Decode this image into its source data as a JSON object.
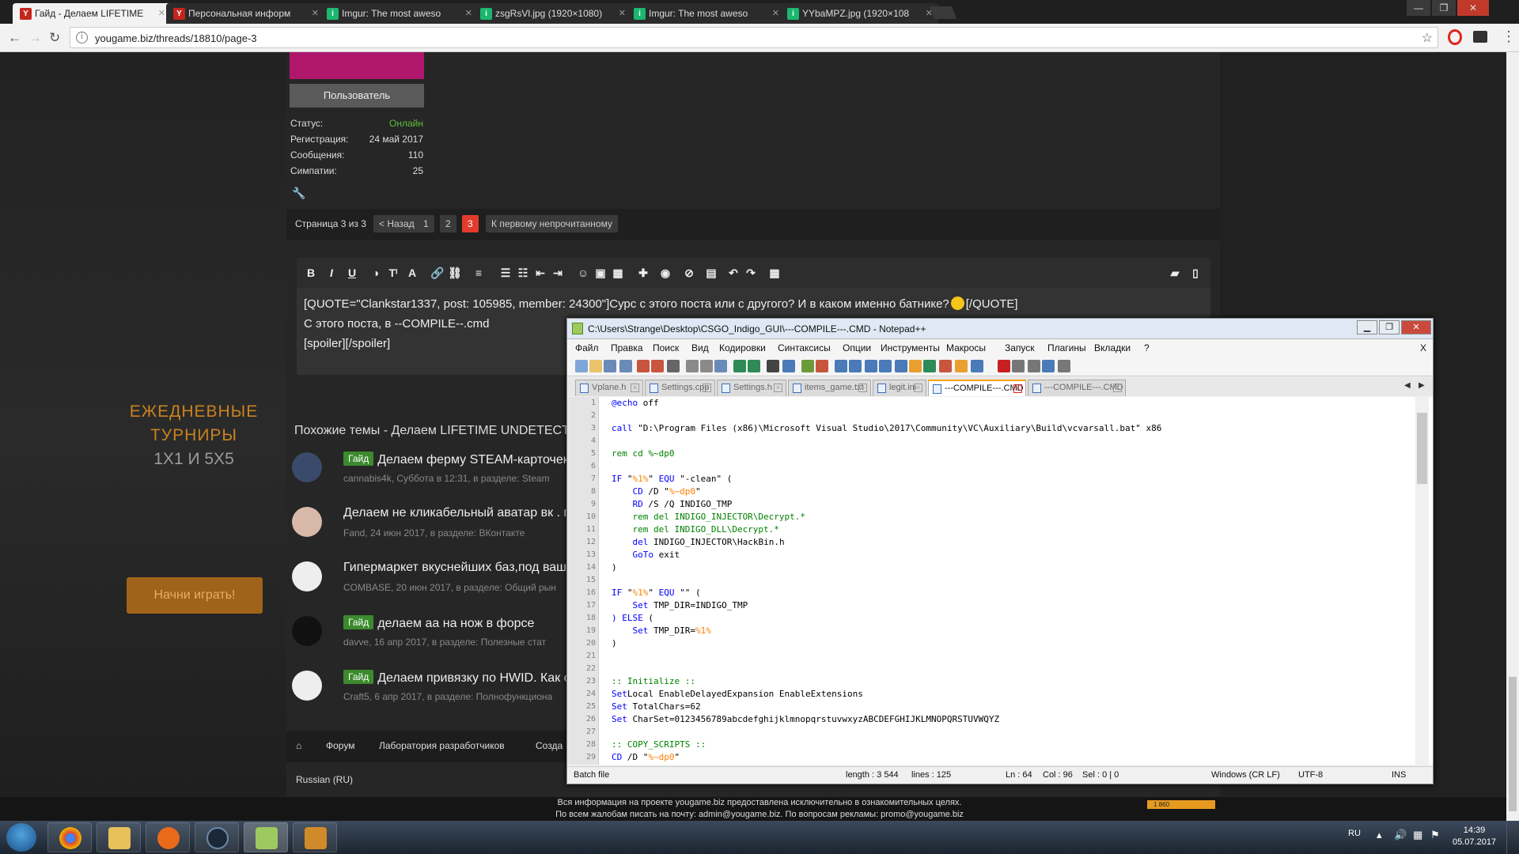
{
  "browser": {
    "tabs": [
      {
        "title": "Гайд - Делаем LIFETIME",
        "favicon": "Y",
        "color": "#c4261d",
        "active": true
      },
      {
        "title": "Персональная информ",
        "favicon": "Y",
        "color": "#c4261d",
        "active": false
      },
      {
        "title": "Imgur: The most aweso",
        "favicon": "i",
        "color": "#1bb76e",
        "active": false
      },
      {
        "title": "zsgRsVl.jpg (1920×1080)",
        "favicon": "i",
        "color": "#1bb76e",
        "active": false
      },
      {
        "title": "Imgur: The most aweso",
        "favicon": "i",
        "color": "#1bb76e",
        "active": false
      },
      {
        "title": "YYbaMPZ.jpg (1920×108",
        "favicon": "i",
        "color": "#1bb76e",
        "active": false
      }
    ],
    "url": "yougame.biz/threads/18810/page-3"
  },
  "sidebar": {
    "promo_line1": "ЕЖЕДНЕВНЫЕ",
    "promo_line2": "ТУРНИРЫ",
    "promo_line3": "1Х1 И 5Х5",
    "play_button": "Начни играть!"
  },
  "user": {
    "role": "Пользователь",
    "stats": [
      {
        "label": "Статус:",
        "value": "Онлайн"
      },
      {
        "label": "Регистрация:",
        "value": "24 май 2017"
      },
      {
        "label": "Сообщения:",
        "value": "110"
      },
      {
        "label": "Симпатии:",
        "value": "25"
      }
    ]
  },
  "pagination": {
    "label": "Страница 3 из 3",
    "prev": "< Назад",
    "pages": [
      "1",
      "2",
      "3"
    ],
    "current": "3",
    "first_unread": "К первому непрочитанному"
  },
  "editor": {
    "line1": "[QUOTE=\"Clankstar1337, post: 105985, member: 24300\"]Сурс с этого поста или с другого? И в каком именно батнике?",
    "line1_end": "[/QUOTE]",
    "line2": "С этого поста, в --COMPILE--.cmd",
    "line3": "[spoiler][/spoiler]"
  },
  "similar": {
    "heading": "Похожие темы - Делаем LIFETIME UNDETECTED",
    "threads": [
      {
        "badge": "Гайд",
        "title": "Делаем ферму STEAM-карточек",
        "meta": "cannabis4k, Суббота в 12:31, в разделе: Steam"
      },
      {
        "badge": "",
        "title": "Делаем не кликабельный аватар вк . г",
        "meta": "Fand, 24 июн 2017, в разделе: ВКонтакте"
      },
      {
        "badge": "",
        "title": "Гипермаркет вкуснейших баз,под ваш",
        "meta": "COMBASE, 20 июн 2017, в разделе: Общий рын"
      },
      {
        "badge": "Гайд",
        "title": "делаем аа на нож в форсе",
        "meta": "davve, 16 апр 2017, в разделе: Полезные стат"
      },
      {
        "badge": "Гайд",
        "title": "Делаем привязку по HWID. Как с",
        "meta": "Craft5, 6 апр 2017, в разделе: Полнофункциона"
      }
    ]
  },
  "footer_nav": {
    "forum": "Форум",
    "lab": "Лаборатория разработчиков",
    "create": "Созда"
  },
  "language": "Russian (RU)",
  "site_footer": {
    "line1": "Вся информация на проекте yougame.biz предоставлена исключительно в ознакомительных целях.",
    "line2": "По всем жалобам писать на почту: admin@yougame.biz. По вопросам рекламы: promo@yougame.biz",
    "counter": "1 860"
  },
  "notepad": {
    "title": "C:\\Users\\Strange\\Desktop\\CSGO_Indigo_GUI\\---COMPILE---.CMD - Notepad++",
    "menu": [
      "Файл",
      "Правка",
      "Поиск",
      "Вид",
      "Кодировки",
      "Синтаксисы",
      "Опции",
      "Инструменты",
      "Макросы",
      "Запуск",
      "Плагины",
      "Вкладки",
      "?"
    ],
    "close_menu": "X",
    "tabs": [
      {
        "name": "Vplane.h",
        "active": false
      },
      {
        "name": "Settings.cpp",
        "active": false
      },
      {
        "name": "Settings.h",
        "active": false
      },
      {
        "name": "items_game.txt",
        "active": false
      },
      {
        "name": "legit.ini",
        "active": false
      },
      {
        "name": "---COMPILE---.CMD",
        "active": true
      },
      {
        "name": "---COMPILE---.CMD",
        "active": false
      }
    ],
    "code": [
      "@echo off",
      "",
      "call \"D:\\Program Files (x86)\\Microsoft Visual Studio\\2017\\Community\\VC\\Auxiliary\\Build\\vcvarsall.bat\" x86",
      "",
      "rem cd %~dp0",
      "",
      "IF \"%1%\" EQU \"-clean\" (",
      "    CD /D \"%~dp0\"",
      "    RD /S /Q INDIGO_TMP",
      "    rem del INDIGO_INJECTOR\\Decrypt.*",
      "    rem del INDIGO_DLL\\Decrypt.*",
      "    del INDIGO_INJECTOR\\HackBin.h",
      "    GoTo exit",
      ")",
      "",
      "IF \"%1%\" EQU \"\" (",
      "    Set TMP_DIR=INDIGO_TMP",
      ") ELSE (",
      "    Set TMP_DIR=%1%",
      ")",
      "",
      "",
      ":: Initialize ::",
      "SetLocal EnableDelayedExpansion EnableExtensions",
      "Set TotalChars=62",
      "Set CharSet=0123456789abcdefghijklmnopqrstuvwxyzABCDEFGHIJKLMNOPQRSTUVWQYZ",
      "",
      ":: COPY_SCRIPTS ::",
      "CD /D \"%~dp0\""
    ],
    "status": {
      "type": "Batch file",
      "length": "length : 3 544",
      "lines": "lines : 125",
      "ln": "Ln : 64",
      "col": "Col : 96",
      "sel": "Sel : 0 | 0",
      "eol": "Windows (CR LF)",
      "enc": "UTF-8",
      "mode": "INS"
    }
  },
  "taskbar": {
    "lang": "RU",
    "time": "14:39",
    "date": "05.07.2017"
  }
}
